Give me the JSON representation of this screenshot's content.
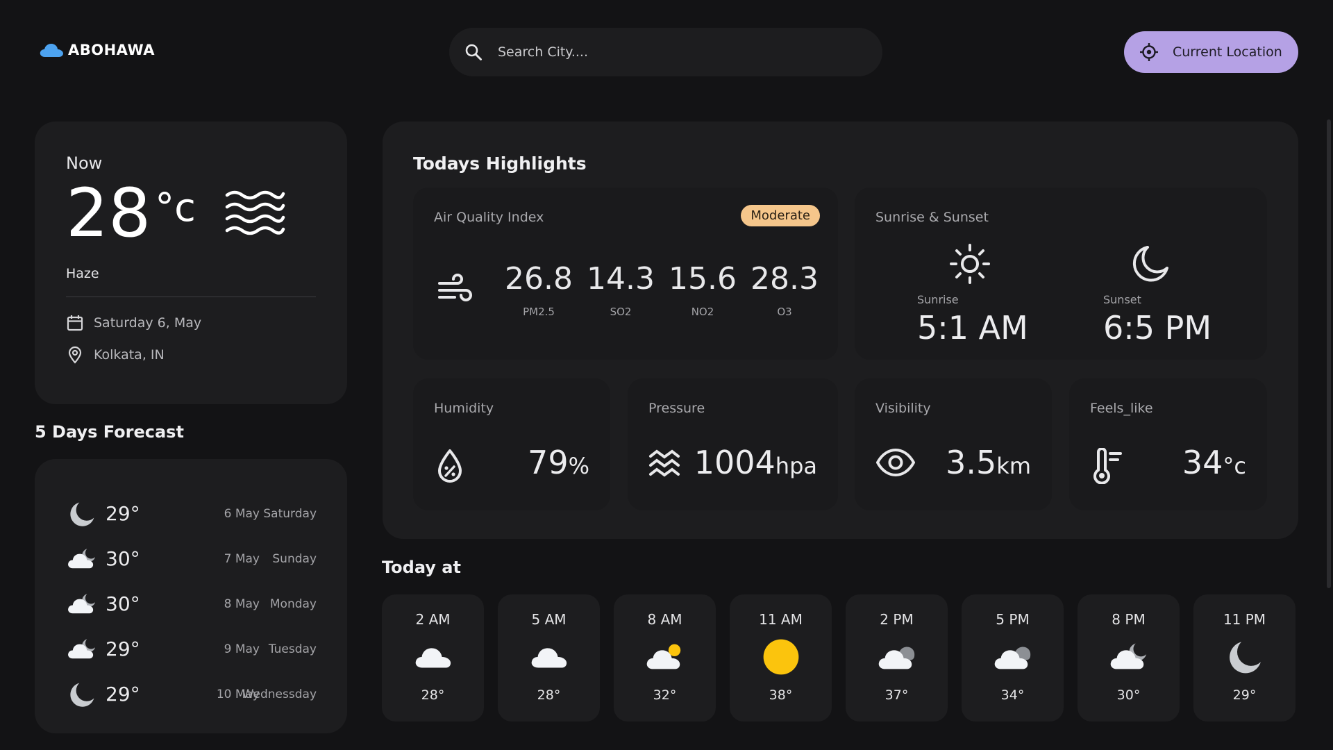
{
  "header": {
    "logo_text": "ABOHAWA",
    "search_placeholder": "Search City....",
    "location_button": "Current Location"
  },
  "now": {
    "label": "Now",
    "temp": "28",
    "unit": "°c",
    "condition": "Haze",
    "date": "Saturday 6, May",
    "location": "Kolkata, IN"
  },
  "forecast": {
    "title": "5 Days Forecast",
    "items": [
      {
        "temp": "29°",
        "date": "6 May",
        "day": "Saturday",
        "icon": "moon-icon"
      },
      {
        "temp": "30°",
        "date": "7 May",
        "day": "Sunday",
        "icon": "cloud-moon-icon"
      },
      {
        "temp": "30°",
        "date": "8 May",
        "day": "Monday",
        "icon": "cloud-moon-icon"
      },
      {
        "temp": "29°",
        "date": "9 May",
        "day": "Tuesday",
        "icon": "cloud-moon-icon"
      },
      {
        "temp": "29°",
        "date": "10 May",
        "day": "Wednessday",
        "icon": "moon-icon"
      }
    ]
  },
  "highlights": {
    "title": "Todays Highlights",
    "aqi": {
      "label": "Air Quality Index",
      "badge": "Moderate",
      "items": [
        {
          "value": "26.8",
          "label": "PM2.5"
        },
        {
          "value": "14.3",
          "label": "SO2"
        },
        {
          "value": "15.6",
          "label": "NO2"
        },
        {
          "value": "28.3",
          "label": "O3"
        }
      ]
    },
    "sun": {
      "label": "Sunrise & Sunset",
      "sunrise_label": "Sunrise",
      "sunrise": "5:1 AM",
      "sunset_label": "Sunset",
      "sunset": "6:5 PM"
    },
    "humidity": {
      "label": "Humidity",
      "value": "79",
      "unit": "%"
    },
    "pressure": {
      "label": "Pressure",
      "value": "1004",
      "unit": "hpa"
    },
    "visibility": {
      "label": "Visibility",
      "value": "3.5",
      "unit": "km"
    },
    "feels_like": {
      "label": "Feels_like",
      "value": "34",
      "unit": "°c"
    }
  },
  "today": {
    "title": "Today at",
    "hours": [
      {
        "time": "2 AM",
        "temp": "28°",
        "icon": "cloud-icon"
      },
      {
        "time": "5 AM",
        "temp": "28°",
        "icon": "cloud-icon"
      },
      {
        "time": "8 AM",
        "temp": "32°",
        "icon": "cloud-sun-icon"
      },
      {
        "time": "11 AM",
        "temp": "38°",
        "icon": "sun-icon"
      },
      {
        "time": "2 PM",
        "temp": "37°",
        "icon": "cloudy-icon"
      },
      {
        "time": "5 PM",
        "temp": "34°",
        "icon": "cloudy-icon"
      },
      {
        "time": "8 PM",
        "temp": "30°",
        "icon": "cloud-moon-icon"
      },
      {
        "time": "11 PM",
        "temp": "29°",
        "icon": "moon-icon"
      }
    ]
  },
  "colors": {
    "background": "#131315",
    "card": "#1d1d1f",
    "accent": "#b5a1e5",
    "badge": "#f5c68b",
    "sun": "#fbc40d"
  }
}
